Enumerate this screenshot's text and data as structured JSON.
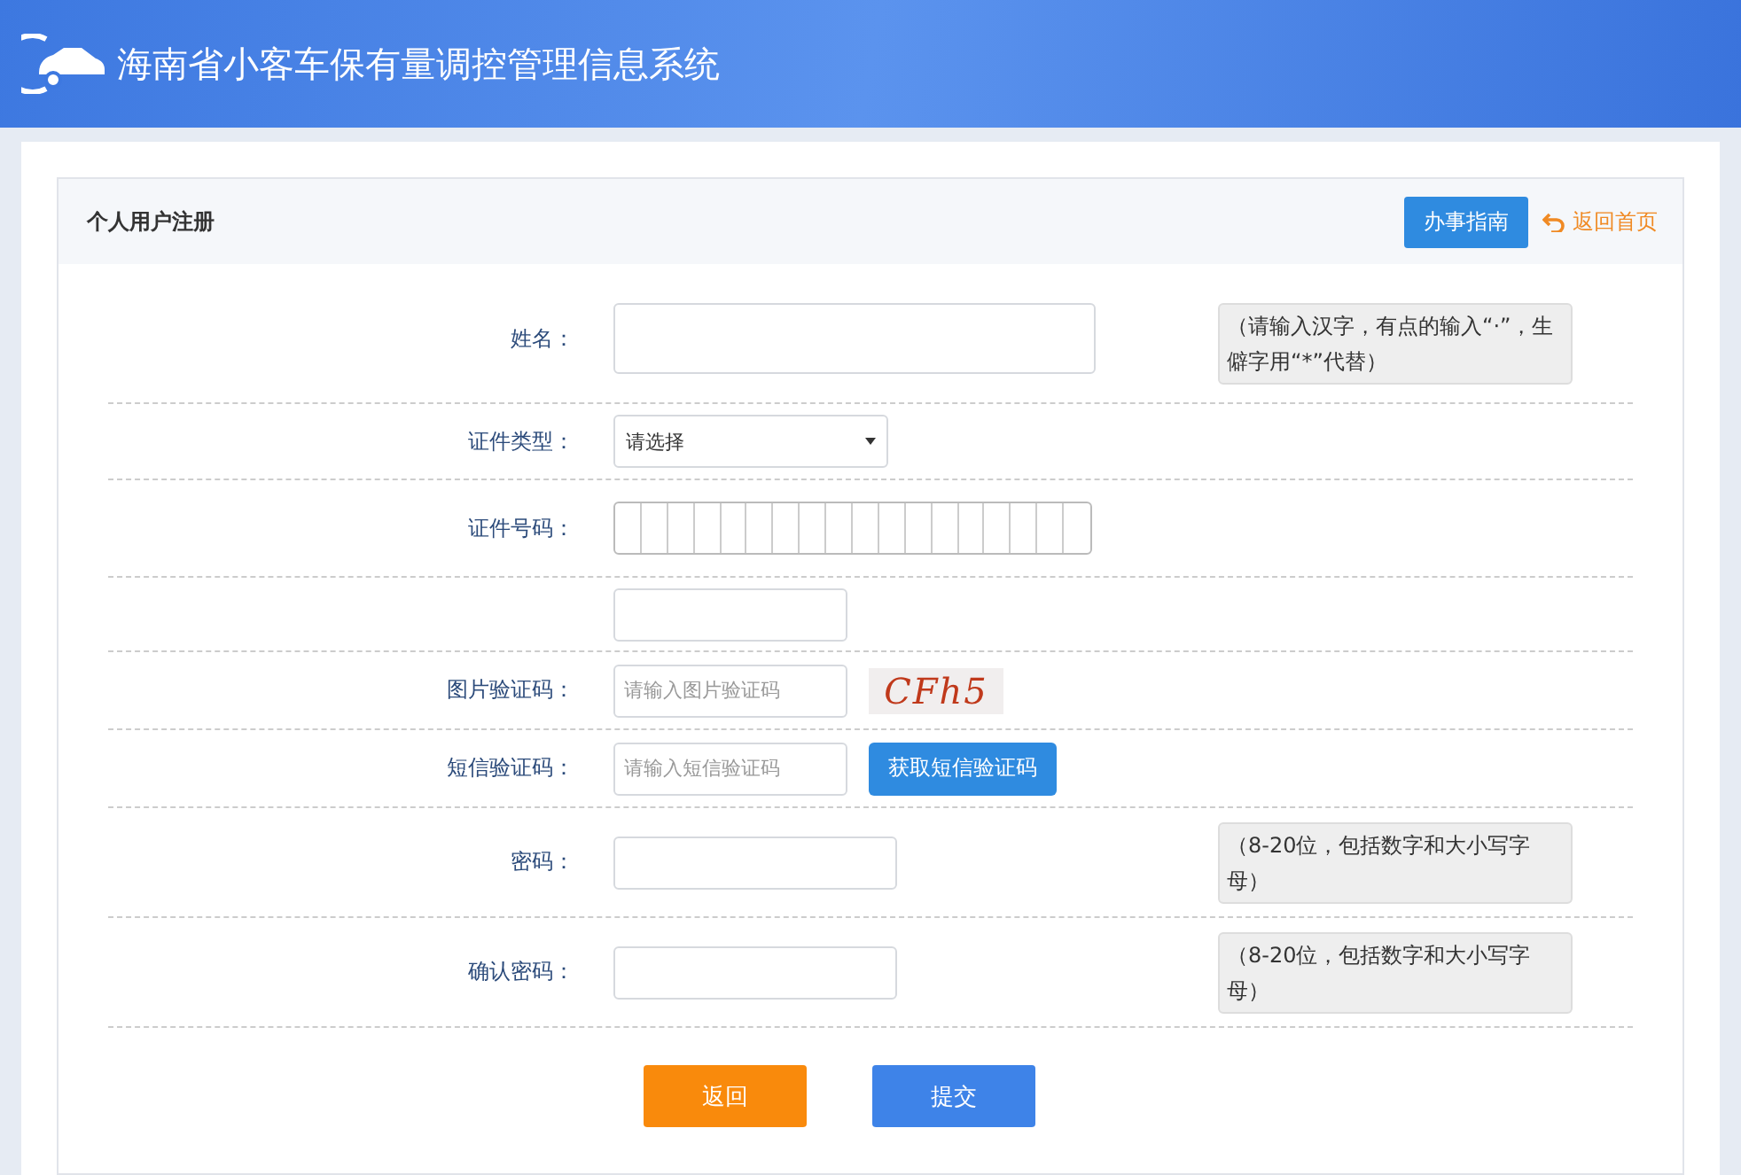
{
  "header": {
    "title": "海南省小客车保有量调控管理信息系统"
  },
  "panel": {
    "title": "个人用户注册",
    "guide_button": "办事指南",
    "home_link": "返回首页"
  },
  "fields": [
    {
      "kind": "text",
      "label": "姓名：",
      "hint": "（请输入汉字，有点的输入“·”，生僻字用“*”代替）"
    },
    {
      "kind": "select",
      "label": "证件类型：",
      "value": "请选择"
    },
    {
      "kind": "cells",
      "label": "证件号码："
    },
    {
      "kind": "hidden"
    },
    {
      "kind": "captcha",
      "label": "图片验证码：",
      "placeholder": "请输入图片验证码",
      "captcha": "CFh5"
    },
    {
      "kind": "sms",
      "label": "短信验证码：",
      "placeholder": "请输入短信验证码",
      "button": "获取短信验证码"
    },
    {
      "kind": "password",
      "label": "密码：",
      "hint": "（8-20位，包括数字和大小写字母）"
    },
    {
      "kind": "password",
      "label": "确认密码：",
      "hint": "（8-20位，包括数字和大小写字母）"
    }
  ],
  "actions": {
    "back": "返回",
    "submit": "提交"
  }
}
